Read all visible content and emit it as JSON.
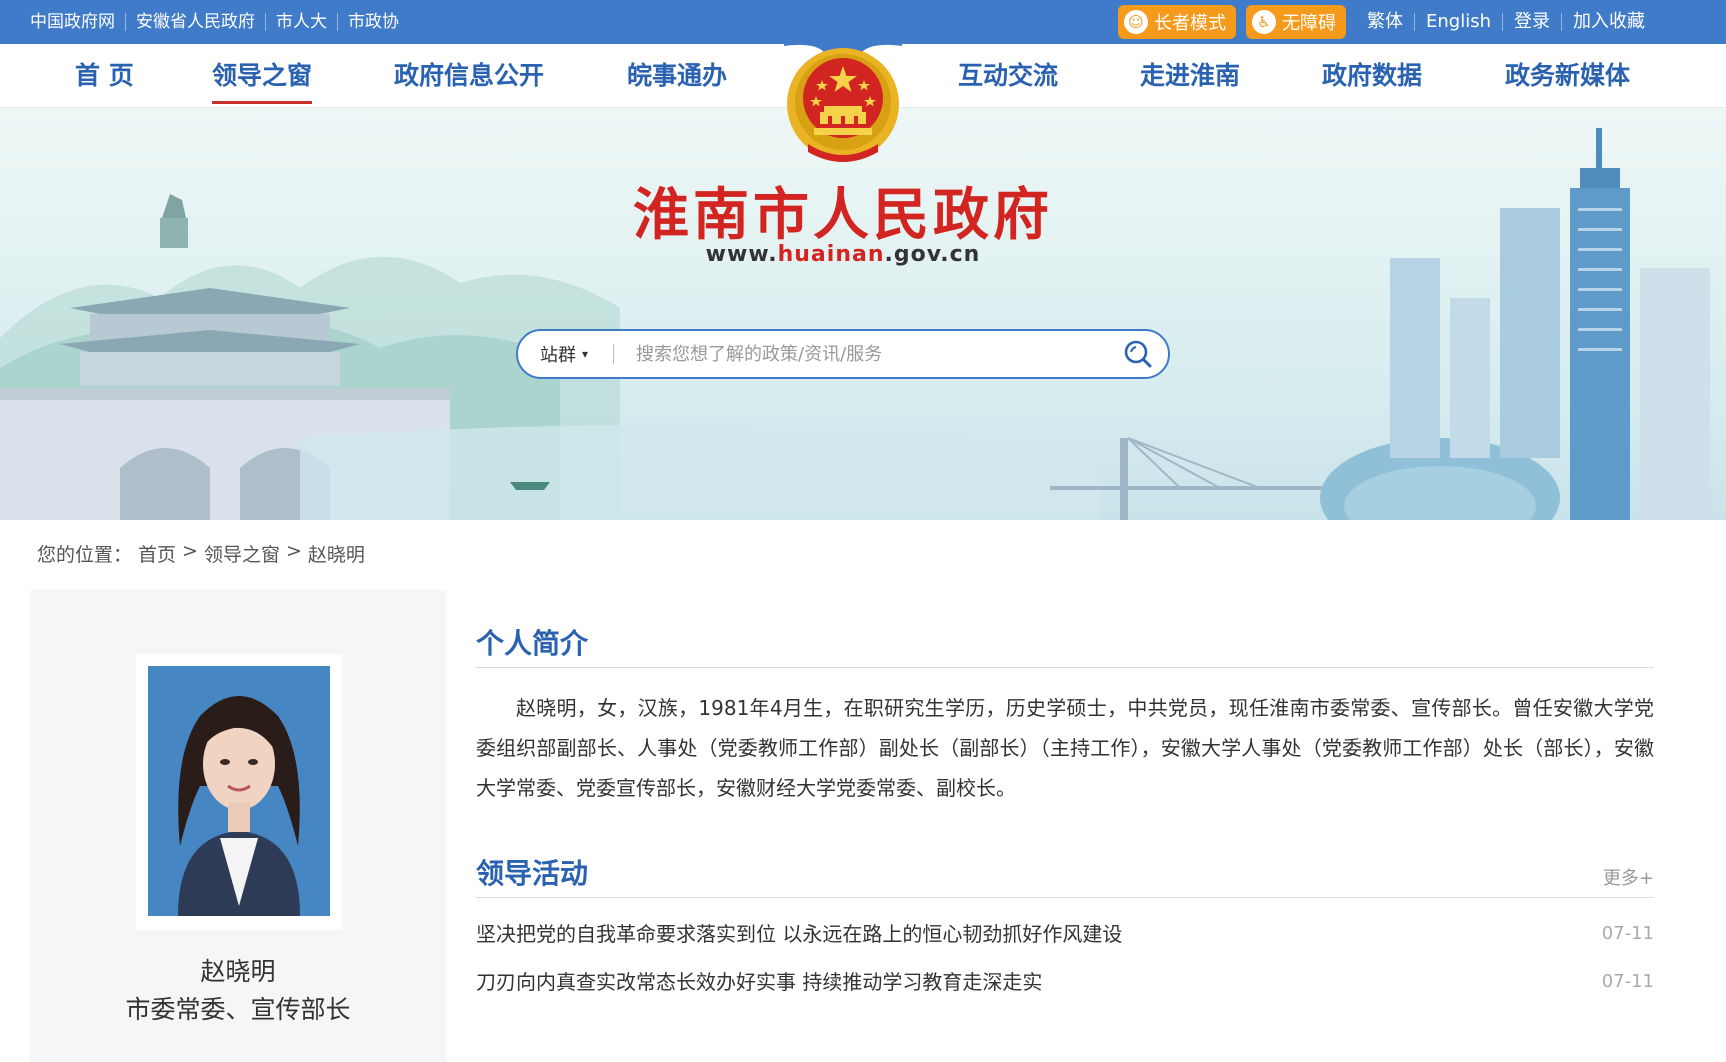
{
  "topbar": {
    "links": [
      "中国政府网",
      "安徽省人民政府",
      "市人大",
      "市政协"
    ],
    "elder_mode": "长者模式",
    "accessibility": "无障碍",
    "traditional": "繁体",
    "english": "English",
    "login": "登录",
    "favorite": "加入收藏"
  },
  "nav": {
    "items": [
      "首 页",
      "领导之窗",
      "政府信息公开",
      "皖事通办",
      "互动交流",
      "走进淮南",
      "政府数据",
      "政务新媒体"
    ],
    "active_index": 1
  },
  "banner": {
    "title": "淮南市人民政府",
    "url_prefix": "www.",
    "url_highlight": "huainan",
    "url_suffix": ".gov.cn"
  },
  "search": {
    "scope": "站群",
    "placeholder": "搜索您想了解的政策/资讯/服务"
  },
  "breadcrumb": {
    "label": "您的位置：",
    "home": "首页",
    "section": "领导之窗",
    "current": "赵晓明",
    "sep": ">"
  },
  "profile": {
    "name": "赵晓明",
    "title": "市委常委、宣传部长"
  },
  "intro": {
    "heading": "个人简介",
    "text": "赵晓明，女，汉族，1981年4月生，在职研究生学历，历史学硕士，中共党员，现任淮南市委常委、宣传部长。曾任安徽大学党委组织部副部长、人事处（党委教师工作部）副处长（副部长）（主持工作），安徽大学人事处（党委教师工作部）处长（部长），安徽大学常委、党委宣传部长，安徽财经大学党委常委、副校长。"
  },
  "activities": {
    "heading": "领导活动",
    "more": "更多+",
    "items": [
      {
        "title": "坚决把党的自我革命要求落实到位 以永远在路上的恒心韧劲抓好作风建设",
        "date": "07-11"
      },
      {
        "title": "刀刃向内真查实改常态长效办好实事 持续推动学习教育走深走实",
        "date": "07-11"
      }
    ]
  },
  "colors": {
    "topbar": "#3f7bc8",
    "nav_text": "#2a62b1",
    "title_red": "#d22420",
    "accent_orange": "#f59a1b"
  }
}
